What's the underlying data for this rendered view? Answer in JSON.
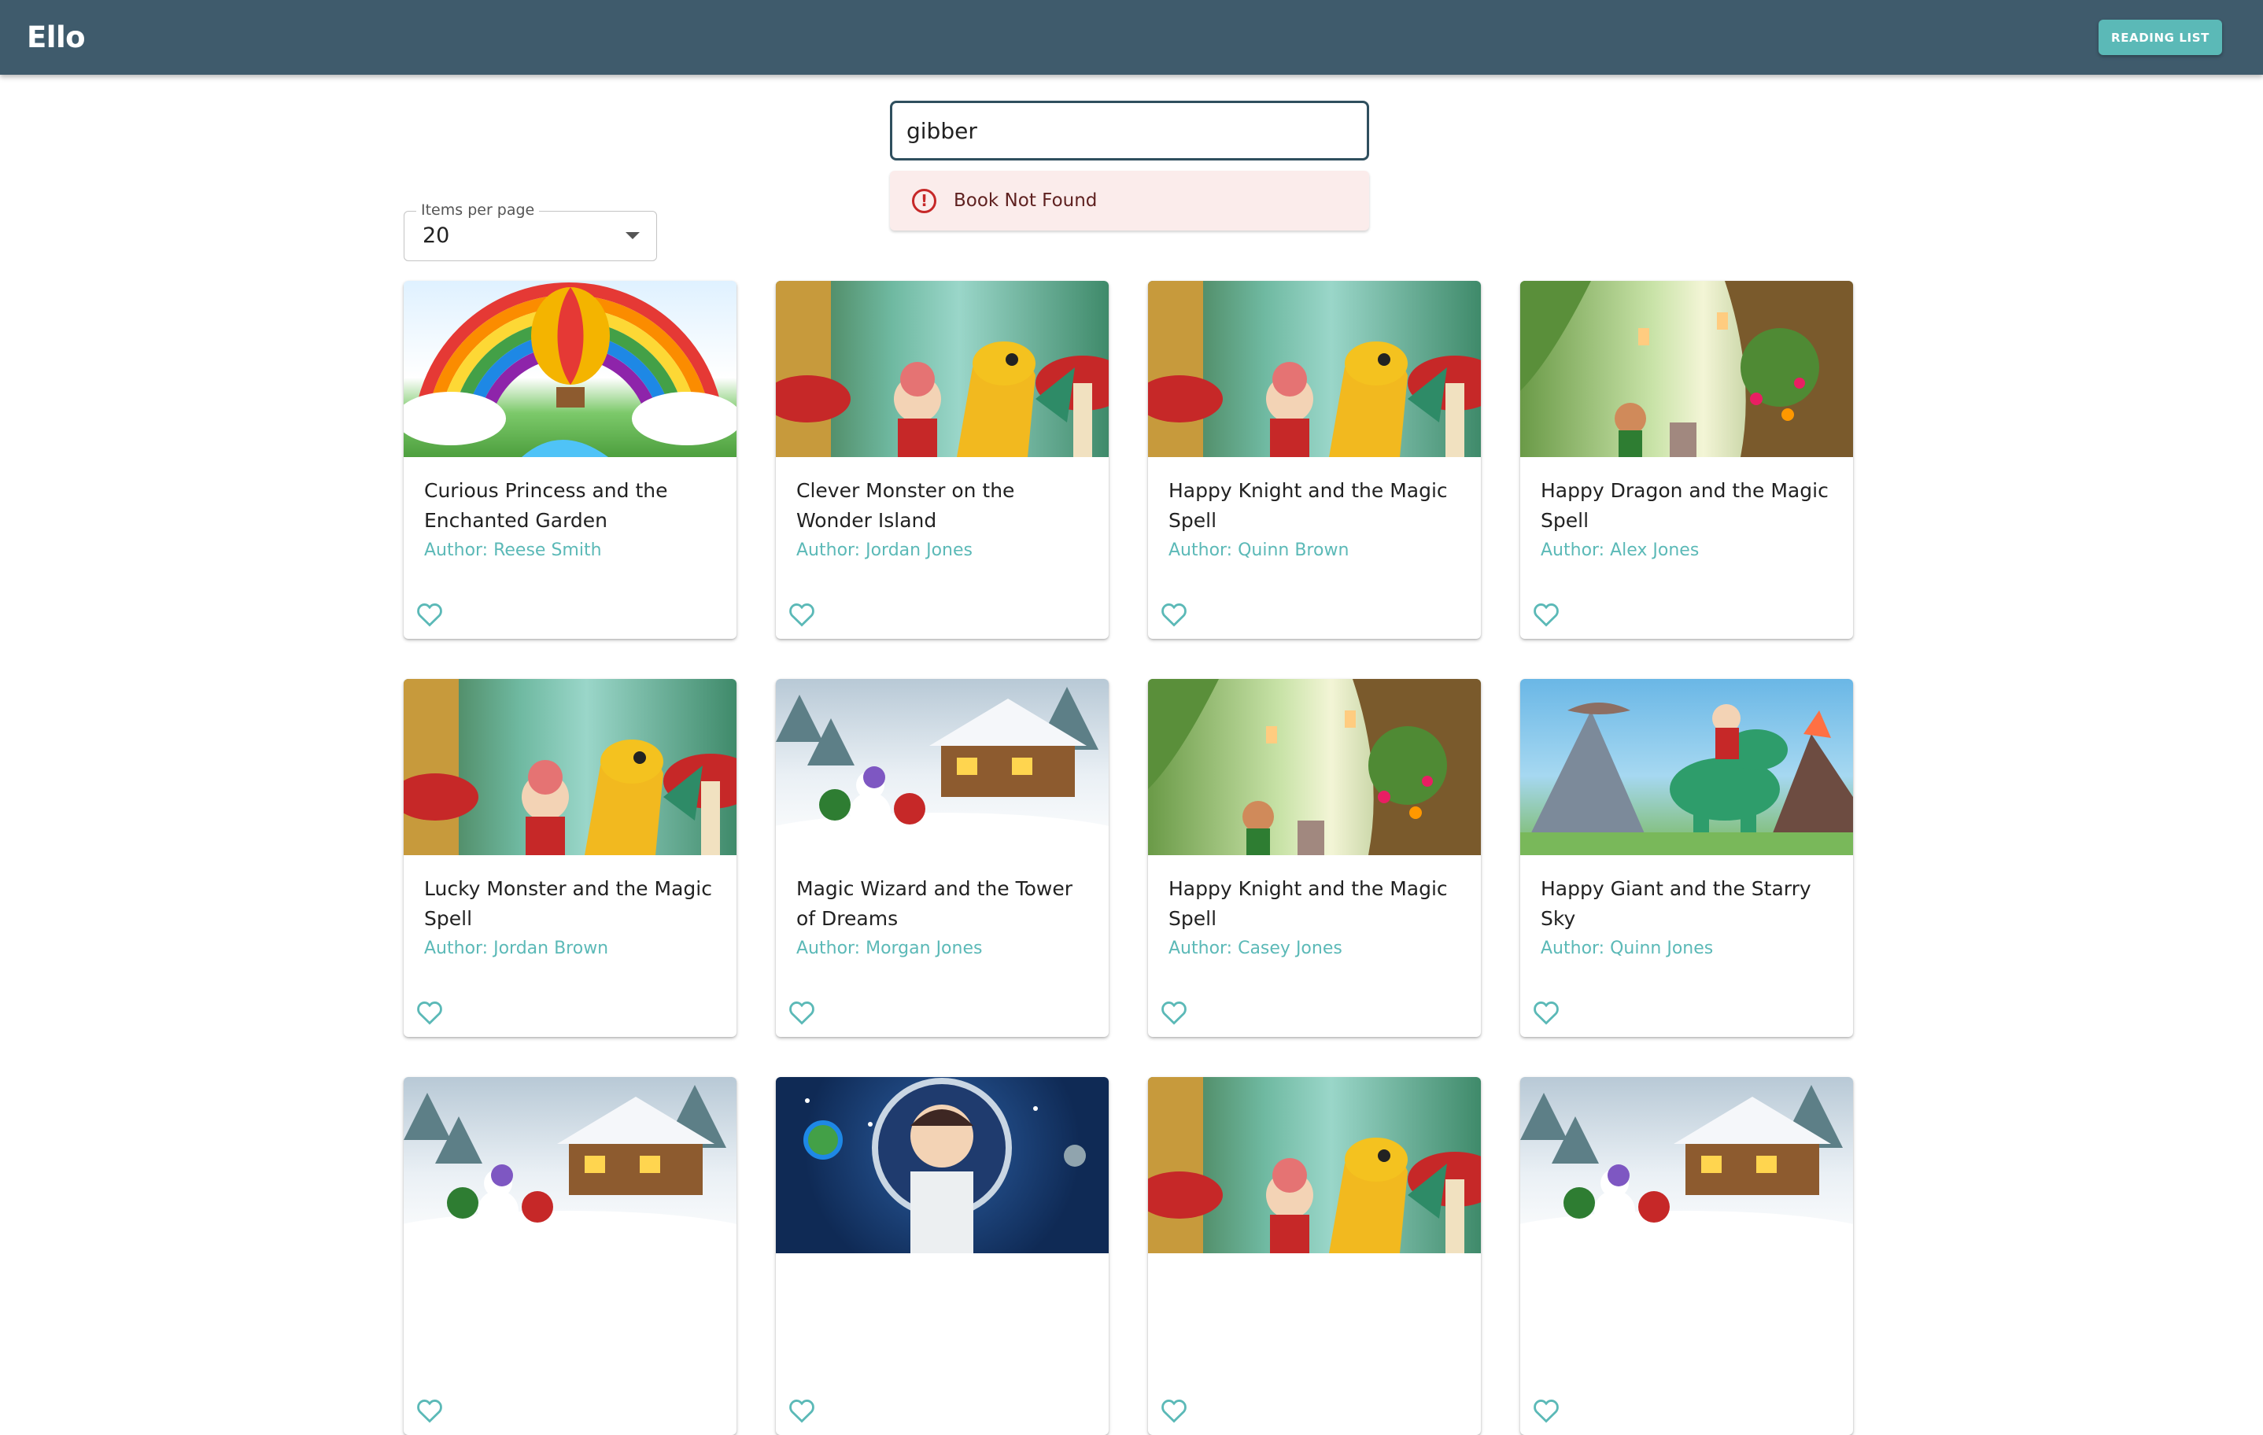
{
  "app": {
    "brand": "Ello",
    "reading_list_label": "READING LIST"
  },
  "search": {
    "value": "gibber",
    "alert_icon": "error-circle-icon",
    "alert_text": "Book Not Found"
  },
  "pagination": {
    "label": "Items per page",
    "value": "20"
  },
  "books": [
    {
      "title": "Curious Princess and the Enchanted Garden",
      "author": "Author: Reese Smith",
      "cover": "rainbow-balloon"
    },
    {
      "title": "Clever Monster on the Wonder Island",
      "author": "Author: Jordan Jones",
      "cover": "forest-dragon"
    },
    {
      "title": "Happy Knight and the Magic Spell",
      "author": "Author: Quinn Brown",
      "cover": "forest-dragon"
    },
    {
      "title": "Happy Dragon and the Magic Spell",
      "author": "Author: Alex Jones",
      "cover": "enchanted-tree"
    },
    {
      "title": "Lucky Monster and the Magic Spell",
      "author": "Author: Jordan Brown",
      "cover": "forest-dragon"
    },
    {
      "title": "Magic Wizard and the Tower of Dreams",
      "author": "Author: Morgan Jones",
      "cover": "snowy-cabin"
    },
    {
      "title": "Happy Knight and the Magic Spell",
      "author": "Author: Casey Jones",
      "cover": "enchanted-tree"
    },
    {
      "title": "Happy Giant and the Starry Sky",
      "author": "Author: Quinn Jones",
      "cover": "dinosaur-volcano"
    },
    {
      "title": "",
      "author": "",
      "cover": "snowy-cabin"
    },
    {
      "title": "",
      "author": "",
      "cover": "space-astronaut"
    },
    {
      "title": "",
      "author": "",
      "cover": "forest-dragon"
    },
    {
      "title": "",
      "author": "",
      "cover": "snowy-cabin"
    }
  ],
  "colors": {
    "appbar": "#3f5b6c",
    "accent": "#5bb9b7",
    "alert_bg": "#fbeceb",
    "alert_icon": "#c62828"
  }
}
